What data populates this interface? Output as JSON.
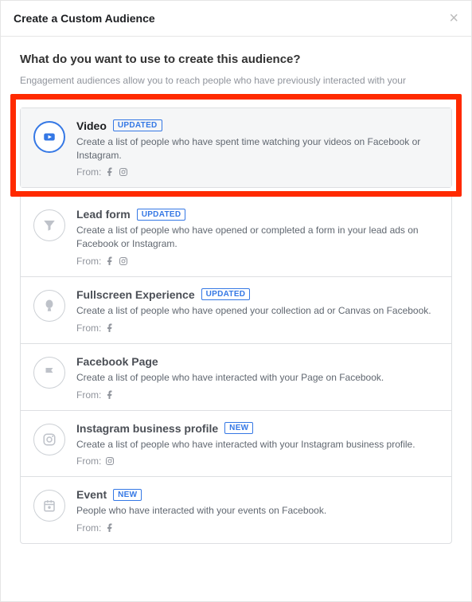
{
  "header": {
    "title": "Create a Custom Audience"
  },
  "body": {
    "question": "What do you want to use to create this audience?",
    "subtext": "Engagement audiences allow you to reach people who have previously interacted with your",
    "from_label": "From:"
  },
  "options": [
    {
      "key": "video",
      "title": "Video",
      "badge": "UPDATED",
      "desc": "Create a list of people who have spent time watching your videos on Facebook or Instagram.",
      "from": [
        "facebook",
        "instagram"
      ],
      "selected": true
    },
    {
      "key": "leadform",
      "title": "Lead form",
      "badge": "UPDATED",
      "desc": "Create a list of people who have opened or completed a form in your lead ads on Facebook or Instagram.",
      "from": [
        "facebook",
        "instagram"
      ],
      "selected": false
    },
    {
      "key": "fullscreen",
      "title": "Fullscreen Experience",
      "badge": "UPDATED",
      "desc": "Create a list of people who have opened your collection ad or Canvas on Facebook.",
      "from": [
        "facebook"
      ],
      "selected": false
    },
    {
      "key": "page",
      "title": "Facebook Page",
      "badge": "",
      "desc": "Create a list of people who have interacted with your Page on Facebook.",
      "from": [
        "facebook"
      ],
      "selected": false
    },
    {
      "key": "igprofile",
      "title": "Instagram business profile",
      "badge": "NEW",
      "desc": "Create a list of people who have interacted with your Instagram business profile.",
      "from": [
        "instagram"
      ],
      "selected": false
    },
    {
      "key": "event",
      "title": "Event",
      "badge": "NEW",
      "desc": "People who have interacted with your events on Facebook.",
      "from": [
        "facebook"
      ],
      "selected": false
    }
  ]
}
